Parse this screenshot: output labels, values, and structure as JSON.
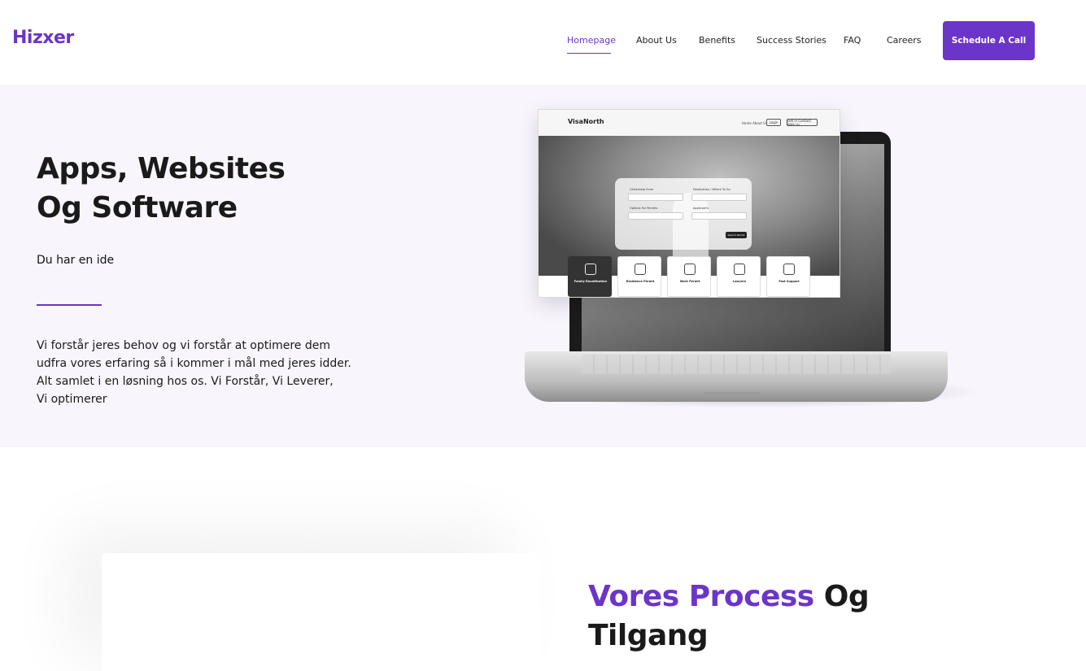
{
  "header": {
    "logo": "Hizxer",
    "nav": [
      {
        "label": "Homepage",
        "active": true
      },
      {
        "label": "About Us"
      },
      {
        "label": "Benefits"
      },
      {
        "label": "Success Stories"
      },
      {
        "label": "FAQ"
      },
      {
        "label": "Careers"
      }
    ],
    "cta_label": "Schedule A Call"
  },
  "hero": {
    "title_line1": "Apps, Websites",
    "title_line2": "Og Software",
    "subtitle": "Du har en ide",
    "body_lines": [
      "Vi forstår jeres behov og vi forstår at optimere dem",
      "udfra vores erfaring så i kommer i mål med jeres idder.",
      "Alt samlet i en løsning hos os. Vi Forstår, Vi Leverer,",
      "Vi optimerer"
    ],
    "illustration": {
      "logo": "VisaNorth",
      "nav_links": "Home   About Us",
      "login": "Login",
      "contact": "Get in Contact With Us",
      "form_labels": [
        "Citizenship From",
        "Destination / Where To Go",
        "Options For Permits",
        "Applicant's"
      ],
      "search": "Search Permit",
      "cards": [
        "Family Reunification",
        "Residence Permit",
        "Work Permit",
        "Lawyers",
        "Fast Support"
      ]
    }
  },
  "process": {
    "title_accent": "Vores Process",
    "title_rest": "Og",
    "title_line2": "Tilgang"
  },
  "colors": {
    "brand": "#6c35c9",
    "hero_bg": "#f8f5fd"
  }
}
